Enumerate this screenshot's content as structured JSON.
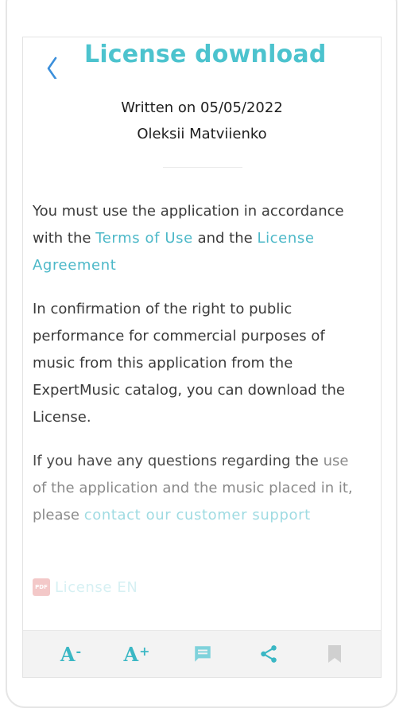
{
  "header": {
    "back_icon": "chevron-left-icon",
    "title": "License download"
  },
  "meta": {
    "date": "Written on 05/05/2022",
    "author": "Oleksii Matviienko"
  },
  "content": {
    "p1_text1": "You must use the application in accordance with the",
    "p1_link1": "Terms of Use",
    "p1_text2": "and the",
    "p1_link2": "License Agreement",
    "p2_text": "In confirmation of the right to public performance for commercial purposes of music from this application from the ExpertMusic catalog, you can download the License.",
    "p3_text1": "If you have any questions regarding the",
    "p3_text2": "use of the application and the music placed in it, please",
    "p3_link": "contact our customer support"
  },
  "attachment": {
    "icon": "pdf-icon",
    "icon_text": "PDF",
    "label": "License EN"
  },
  "toolbar": {
    "decrease_font": "A",
    "decrease_mark": "-",
    "increase_font": "A",
    "increase_mark": "+",
    "comment_icon": "comment-icon",
    "share_icon": "share-icon",
    "bookmark_icon": "bookmark-icon"
  },
  "colors": {
    "accent": "#4cc3ce",
    "text": "#3a3a3a",
    "toolbar_bg": "#f3f3f3"
  }
}
